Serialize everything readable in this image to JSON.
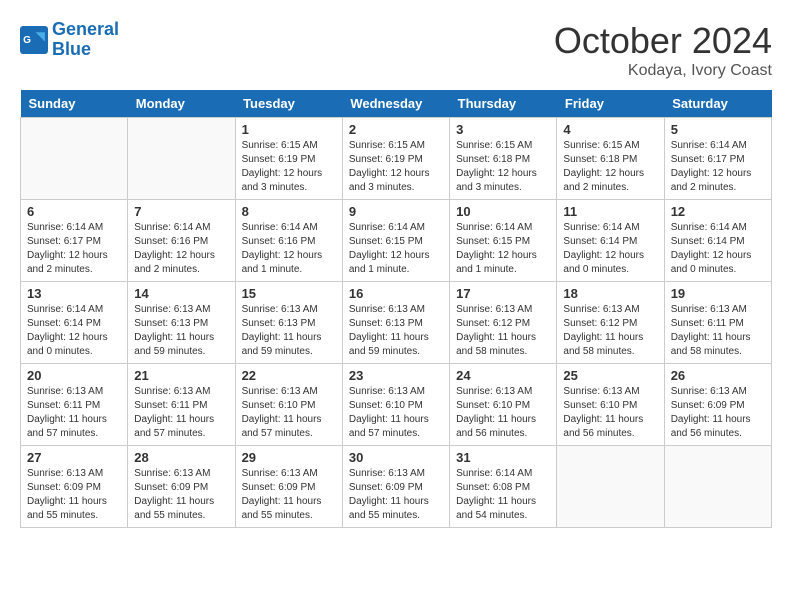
{
  "header": {
    "logo_line1": "General",
    "logo_line2": "Blue",
    "month": "October 2024",
    "location": "Kodaya, Ivory Coast"
  },
  "days_of_week": [
    "Sunday",
    "Monday",
    "Tuesday",
    "Wednesday",
    "Thursday",
    "Friday",
    "Saturday"
  ],
  "weeks": [
    [
      {
        "day": "",
        "info": ""
      },
      {
        "day": "",
        "info": ""
      },
      {
        "day": "1",
        "info": "Sunrise: 6:15 AM\nSunset: 6:19 PM\nDaylight: 12 hours and 3 minutes."
      },
      {
        "day": "2",
        "info": "Sunrise: 6:15 AM\nSunset: 6:19 PM\nDaylight: 12 hours and 3 minutes."
      },
      {
        "day": "3",
        "info": "Sunrise: 6:15 AM\nSunset: 6:18 PM\nDaylight: 12 hours and 3 minutes."
      },
      {
        "day": "4",
        "info": "Sunrise: 6:15 AM\nSunset: 6:18 PM\nDaylight: 12 hours and 2 minutes."
      },
      {
        "day": "5",
        "info": "Sunrise: 6:14 AM\nSunset: 6:17 PM\nDaylight: 12 hours and 2 minutes."
      }
    ],
    [
      {
        "day": "6",
        "info": "Sunrise: 6:14 AM\nSunset: 6:17 PM\nDaylight: 12 hours and 2 minutes."
      },
      {
        "day": "7",
        "info": "Sunrise: 6:14 AM\nSunset: 6:16 PM\nDaylight: 12 hours and 2 minutes."
      },
      {
        "day": "8",
        "info": "Sunrise: 6:14 AM\nSunset: 6:16 PM\nDaylight: 12 hours and 1 minute."
      },
      {
        "day": "9",
        "info": "Sunrise: 6:14 AM\nSunset: 6:15 PM\nDaylight: 12 hours and 1 minute."
      },
      {
        "day": "10",
        "info": "Sunrise: 6:14 AM\nSunset: 6:15 PM\nDaylight: 12 hours and 1 minute."
      },
      {
        "day": "11",
        "info": "Sunrise: 6:14 AM\nSunset: 6:14 PM\nDaylight: 12 hours and 0 minutes."
      },
      {
        "day": "12",
        "info": "Sunrise: 6:14 AM\nSunset: 6:14 PM\nDaylight: 12 hours and 0 minutes."
      }
    ],
    [
      {
        "day": "13",
        "info": "Sunrise: 6:14 AM\nSunset: 6:14 PM\nDaylight: 12 hours and 0 minutes."
      },
      {
        "day": "14",
        "info": "Sunrise: 6:13 AM\nSunset: 6:13 PM\nDaylight: 11 hours and 59 minutes."
      },
      {
        "day": "15",
        "info": "Sunrise: 6:13 AM\nSunset: 6:13 PM\nDaylight: 11 hours and 59 minutes."
      },
      {
        "day": "16",
        "info": "Sunrise: 6:13 AM\nSunset: 6:13 PM\nDaylight: 11 hours and 59 minutes."
      },
      {
        "day": "17",
        "info": "Sunrise: 6:13 AM\nSunset: 6:12 PM\nDaylight: 11 hours and 58 minutes."
      },
      {
        "day": "18",
        "info": "Sunrise: 6:13 AM\nSunset: 6:12 PM\nDaylight: 11 hours and 58 minutes."
      },
      {
        "day": "19",
        "info": "Sunrise: 6:13 AM\nSunset: 6:11 PM\nDaylight: 11 hours and 58 minutes."
      }
    ],
    [
      {
        "day": "20",
        "info": "Sunrise: 6:13 AM\nSunset: 6:11 PM\nDaylight: 11 hours and 57 minutes."
      },
      {
        "day": "21",
        "info": "Sunrise: 6:13 AM\nSunset: 6:11 PM\nDaylight: 11 hours and 57 minutes."
      },
      {
        "day": "22",
        "info": "Sunrise: 6:13 AM\nSunset: 6:10 PM\nDaylight: 11 hours and 57 minutes."
      },
      {
        "day": "23",
        "info": "Sunrise: 6:13 AM\nSunset: 6:10 PM\nDaylight: 11 hours and 57 minutes."
      },
      {
        "day": "24",
        "info": "Sunrise: 6:13 AM\nSunset: 6:10 PM\nDaylight: 11 hours and 56 minutes."
      },
      {
        "day": "25",
        "info": "Sunrise: 6:13 AM\nSunset: 6:10 PM\nDaylight: 11 hours and 56 minutes."
      },
      {
        "day": "26",
        "info": "Sunrise: 6:13 AM\nSunset: 6:09 PM\nDaylight: 11 hours and 56 minutes."
      }
    ],
    [
      {
        "day": "27",
        "info": "Sunrise: 6:13 AM\nSunset: 6:09 PM\nDaylight: 11 hours and 55 minutes."
      },
      {
        "day": "28",
        "info": "Sunrise: 6:13 AM\nSunset: 6:09 PM\nDaylight: 11 hours and 55 minutes."
      },
      {
        "day": "29",
        "info": "Sunrise: 6:13 AM\nSunset: 6:09 PM\nDaylight: 11 hours and 55 minutes."
      },
      {
        "day": "30",
        "info": "Sunrise: 6:13 AM\nSunset: 6:09 PM\nDaylight: 11 hours and 55 minutes."
      },
      {
        "day": "31",
        "info": "Sunrise: 6:14 AM\nSunset: 6:08 PM\nDaylight: 11 hours and 54 minutes."
      },
      {
        "day": "",
        "info": ""
      },
      {
        "day": "",
        "info": ""
      }
    ]
  ]
}
